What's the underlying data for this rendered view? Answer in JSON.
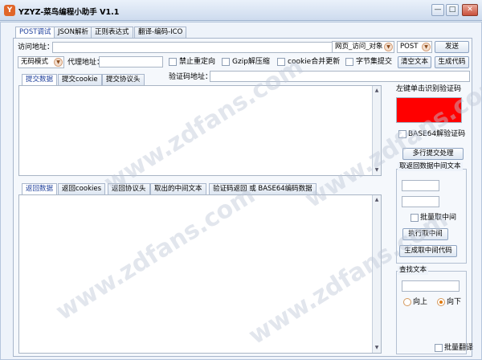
{
  "window": {
    "title": "YZYZ-菜鸟编程小助手 V1.1",
    "icon": "app-logo-icon",
    "minimize": "—",
    "maximize": "□",
    "close": "✕"
  },
  "main_tabs": [
    "POST调试",
    "JSON解析",
    "正则表达式",
    "翻译-编码-ICO"
  ],
  "request": {
    "url_label": "访问地址：",
    "url_value": "",
    "mode_select": "网页_访问_对象",
    "method_select": "POST",
    "send_button": "发送",
    "encoding_select": "无码模式",
    "proxy_label": "代理地址：",
    "proxy_value": "",
    "options": [
      {
        "label": "禁止重定向",
        "checked": false
      },
      {
        "label": "Gzip解压缩",
        "checked": false
      },
      {
        "label": "cookie合并更新",
        "checked": false
      },
      {
        "label": "字节集提交",
        "checked": false
      }
    ],
    "clear_button": "清空文本",
    "gen_code_button": "生成代码",
    "captcha_addr_label": "验证码地址：",
    "captcha_addr_value": ""
  },
  "submit_tabs": [
    "提交数据",
    "提交cookie",
    "提交协议头"
  ],
  "response_tabs": [
    "返回数据",
    "返回cookies",
    "返回协议头",
    "取出的中间文本",
    "验证码返回 或 BASE64编码数据"
  ],
  "right_panel": {
    "captcha_title": "左键单击识别验证码",
    "captcha_color": "#ff0000",
    "base64_checkbox": "BASE64解验证码",
    "multi_submit_button": "多行提交处理",
    "extract_group_title": "取返回数据中间文本",
    "batch_extract_checkbox": "批量取中间",
    "exec_extract_button": "执行取中间",
    "gen_extract_code_button": "生成取中间代码",
    "find_group_title": "查找文本",
    "find_up_label": "向上",
    "find_down_label": "向下",
    "batch_replace_checkbox": "批量翻译"
  },
  "watermark": "www.zdfans.com",
  "accent": "#1d3f9c"
}
